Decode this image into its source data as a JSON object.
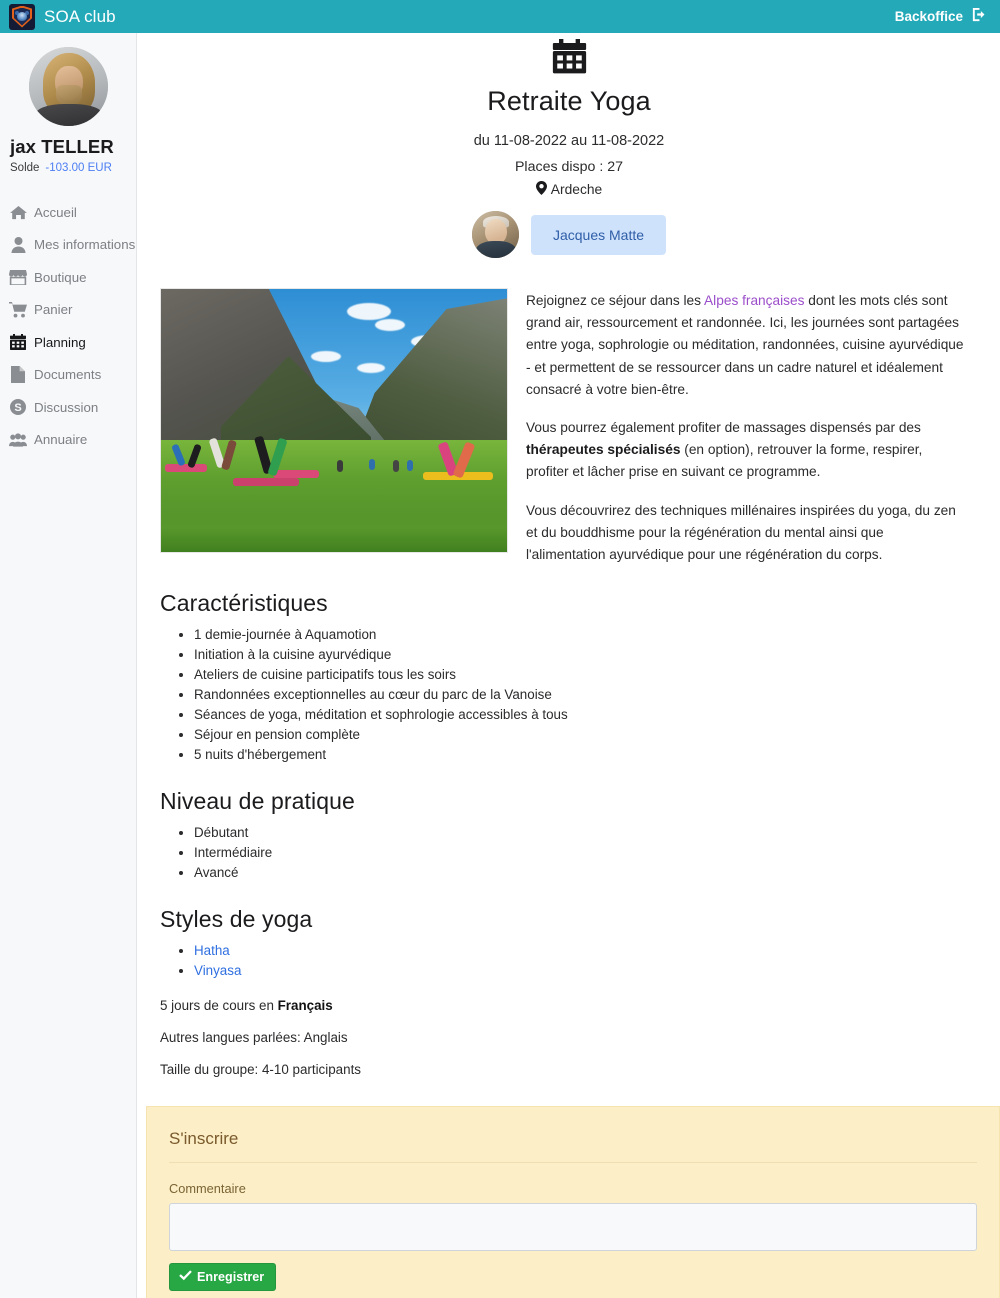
{
  "topbar": {
    "brand_name": "SOA club",
    "logo_icon": "shield-logo-icon",
    "backoffice_label": "Backoffice",
    "exit_icon": "sign-out-icon"
  },
  "sidebar": {
    "avatar_icon": "user-avatar",
    "user_name": "jax TELLER",
    "balance_label": "Solde",
    "balance_value": "-103.00 EUR",
    "balance_color": "#4c7ef3",
    "items": [
      {
        "label": "Accueil",
        "icon": "home-icon",
        "active": false
      },
      {
        "label": "Mes informations",
        "icon": "user-icon",
        "active": false
      },
      {
        "label": "Boutique",
        "icon": "store-icon",
        "active": false
      },
      {
        "label": "Panier",
        "icon": "shopping-cart-icon",
        "active": false
      },
      {
        "label": "Planning",
        "icon": "calendar-icon",
        "active": true
      },
      {
        "label": "Documents",
        "icon": "file-icon",
        "active": false
      },
      {
        "label": "Discussion",
        "icon": "circle-s-icon",
        "active": false
      },
      {
        "label": "Annuaire",
        "icon": "users-icon",
        "active": false
      }
    ]
  },
  "event": {
    "header_icon": "calendar-icon",
    "title": "Retraite Yoga",
    "dates": "du 11-08-2022 au 11-08-2022",
    "places": "Places dispo : 27",
    "location": "Ardeche",
    "location_icon": "map-pin-icon",
    "instructor_avatar_icon": "instructor-avatar",
    "instructor_name": "Jacques Matte",
    "photo_alt": "yoga-class-mountain-meadow-photo",
    "description": [
      {
        "parts": [
          {
            "text": "Rejoignez ce séjour dans les ",
            "style": "normal"
          },
          {
            "text": "Alpes françaises",
            "style": "link"
          },
          {
            "text": " dont les mots clés sont grand air, ressourcement et randonnée. Ici, les journées sont partagées entre yoga, sophrologie ou méditation, randonnées, cuisine ayurvédique - et permettent de se ressourcer dans un cadre naturel et idéalement consacré à votre bien-être.",
            "style": "normal"
          }
        ]
      },
      {
        "parts": [
          {
            "text": "Vous pourrez également profiter de massages dispensés par des ",
            "style": "normal"
          },
          {
            "text": "thérapeutes spécialisés",
            "style": "bold"
          },
          {
            "text": " (en option), retrouver la forme, respirer, profiter et lâcher prise en suivant ce programme.",
            "style": "normal"
          }
        ]
      },
      {
        "parts": [
          {
            "text": "Vous découvrirez des techniques millénaires inspirées du yoga, du zen et du bouddhisme pour la régénération du mental ainsi que l'alimentation ayurvédique pour une régénération du corps.",
            "style": "normal"
          }
        ]
      }
    ],
    "sections": [
      {
        "heading": "Caractéristiques",
        "items": [
          {
            "text": "1 demie-journée à Aquamotion",
            "link": false
          },
          {
            "text": "Initiation à la cuisine ayurvédique",
            "link": false
          },
          {
            "text": "Ateliers de cuisine participatifs tous les soirs",
            "link": false
          },
          {
            "text": "Randonnées exceptionnelles au cœur du parc de la Vanoise",
            "link": false
          },
          {
            "text": "Séances de yoga, méditation et sophrologie accessibles à tous",
            "link": false
          },
          {
            "text": "Séjour en pension complète",
            "link": false
          },
          {
            "text": "5 nuits d'hébergement",
            "link": false
          }
        ]
      },
      {
        "heading": "Niveau de pratique",
        "items": [
          {
            "text": "Débutant",
            "link": false
          },
          {
            "text": "Intermédiaire",
            "link": false
          },
          {
            "text": "Avancé",
            "link": false
          }
        ]
      },
      {
        "heading": "Styles de yoga",
        "items": [
          {
            "text": "Hatha",
            "link": true
          },
          {
            "text": "Vinyasa",
            "link": true
          }
        ]
      }
    ],
    "info_lines": [
      {
        "prefix": "5 jours de cours en ",
        "bold": "Français",
        "suffix": ""
      },
      {
        "prefix": "Autres langues parlées: Anglais",
        "bold": "",
        "suffix": ""
      },
      {
        "prefix": "Taille du groupe: 4-10 participants",
        "bold": "",
        "suffix": ""
      }
    ]
  },
  "register": {
    "title": "S'inscrire",
    "comment_label": "Commentaire",
    "comment_value": "",
    "comment_placeholder": "",
    "save_label": "Enregistrer",
    "save_icon": "check-icon",
    "panel_color": "#fcefc7",
    "save_color": "#28a745"
  }
}
